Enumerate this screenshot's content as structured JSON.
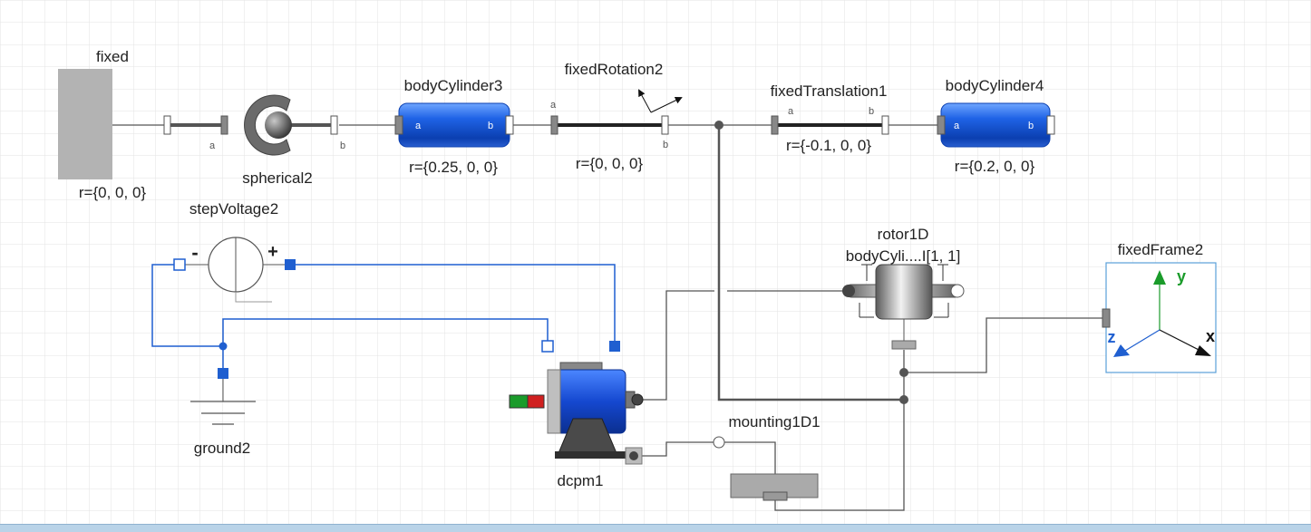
{
  "components": {
    "fixed": {
      "name": "fixed",
      "param": "r={0, 0, 0}"
    },
    "spherical2": {
      "name": "spherical2",
      "port_a": "a",
      "port_b": "b"
    },
    "bodyCylinder3": {
      "name": "bodyCylinder3",
      "param": "r={0.25, 0, 0}",
      "port_a": "a",
      "port_b": "b"
    },
    "fixedRotation2": {
      "name": "fixedRotation2",
      "param": "r={0, 0, 0}",
      "port_a": "a",
      "port_b": "b"
    },
    "fixedTranslation1": {
      "name": "fixedTranslation1",
      "param": "r={-0.1, 0, 0}",
      "port_a": "a",
      "port_b": "b"
    },
    "bodyCylinder4": {
      "name": "bodyCylinder4",
      "param": "r={0.2, 0, 0}",
      "port_a": "a",
      "port_b": "b"
    },
    "stepVoltage2": {
      "name": "stepVoltage2",
      "minus": "-",
      "plus": "+"
    },
    "ground2": {
      "name": "ground2"
    },
    "dcpm1": {
      "name": "dcpm1"
    },
    "rotor1D": {
      "name": "rotor1D",
      "param": "bodyCyli....I[1, 1]"
    },
    "mounting1D1": {
      "name": "mounting1D1"
    },
    "fixedFrame2": {
      "name": "fixedFrame2",
      "axis_x": "x",
      "axis_y": "y",
      "axis_z": "z"
    }
  },
  "colors": {
    "mech_line": "#555555",
    "elec_line": "#1f5fd0",
    "body_blue": "#1f63e6",
    "fixed_gray": "#b3b3b3",
    "grid": "#e3e3e3",
    "frame_border": "#5aa0d8",
    "axis_green": "#1a9b2a",
    "axis_blue": "#1f5fd0"
  }
}
